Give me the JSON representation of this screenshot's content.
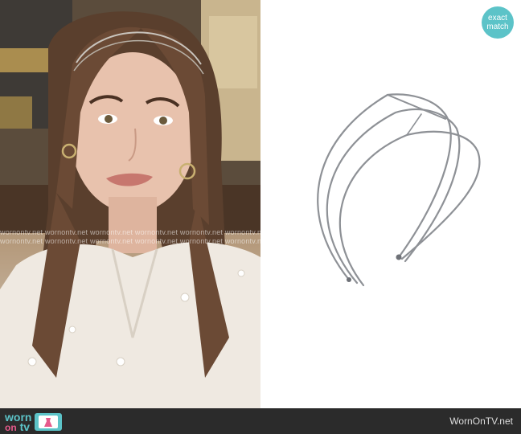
{
  "badge": {
    "line1": "exact",
    "line2": "match"
  },
  "watermark": {
    "text": "wornontv.net"
  },
  "footer": {
    "logo_word1": "worn",
    "logo_word2": "on",
    "logo_word3": "tv",
    "site_url": "WornOnTV.net"
  },
  "colors": {
    "accent": "#5cc3c8",
    "logo_pink": "#e65a8c",
    "footer_bg": "#2b2b2b"
  }
}
